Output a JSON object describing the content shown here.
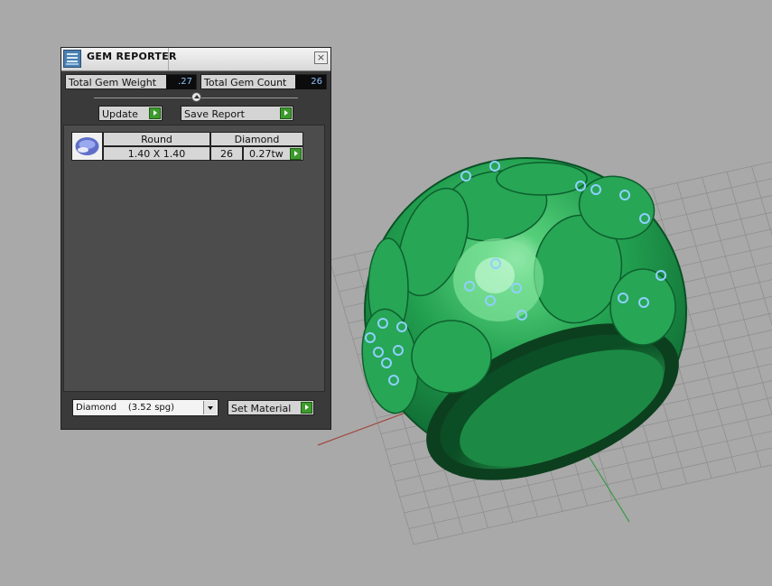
{
  "panel": {
    "title": "GEM REPORTER",
    "close_glyph": "×",
    "total_weight_label": "Total Gem Weight",
    "total_weight_value": ".27",
    "total_count_label": "Total Gem Count",
    "total_count_value": "26",
    "update_label": "Update",
    "save_report_label": "Save Report",
    "table": {
      "shape": "Round",
      "size": "1.40 X 1.40",
      "material": "Diamond",
      "count": "26",
      "weight": "0.27tw"
    },
    "material_select": {
      "value": "Diamond    (3.52 spg)"
    },
    "set_material_label": "Set Material"
  },
  "colors": {
    "ring": "#1f9a4a",
    "gem": "#7fc4ff",
    "grid_bg": "#a9a9a9",
    "panel_bg": "#3a3a3a",
    "value_text": "#8ec2ff",
    "play_green": "#3d9a2c"
  },
  "icons": {
    "title": "gem-reporter-app-icon",
    "close": "close-icon",
    "play": "play-arrow-icon",
    "dropdown": "chevron-down-icon",
    "gem": "round-gem-icon"
  }
}
